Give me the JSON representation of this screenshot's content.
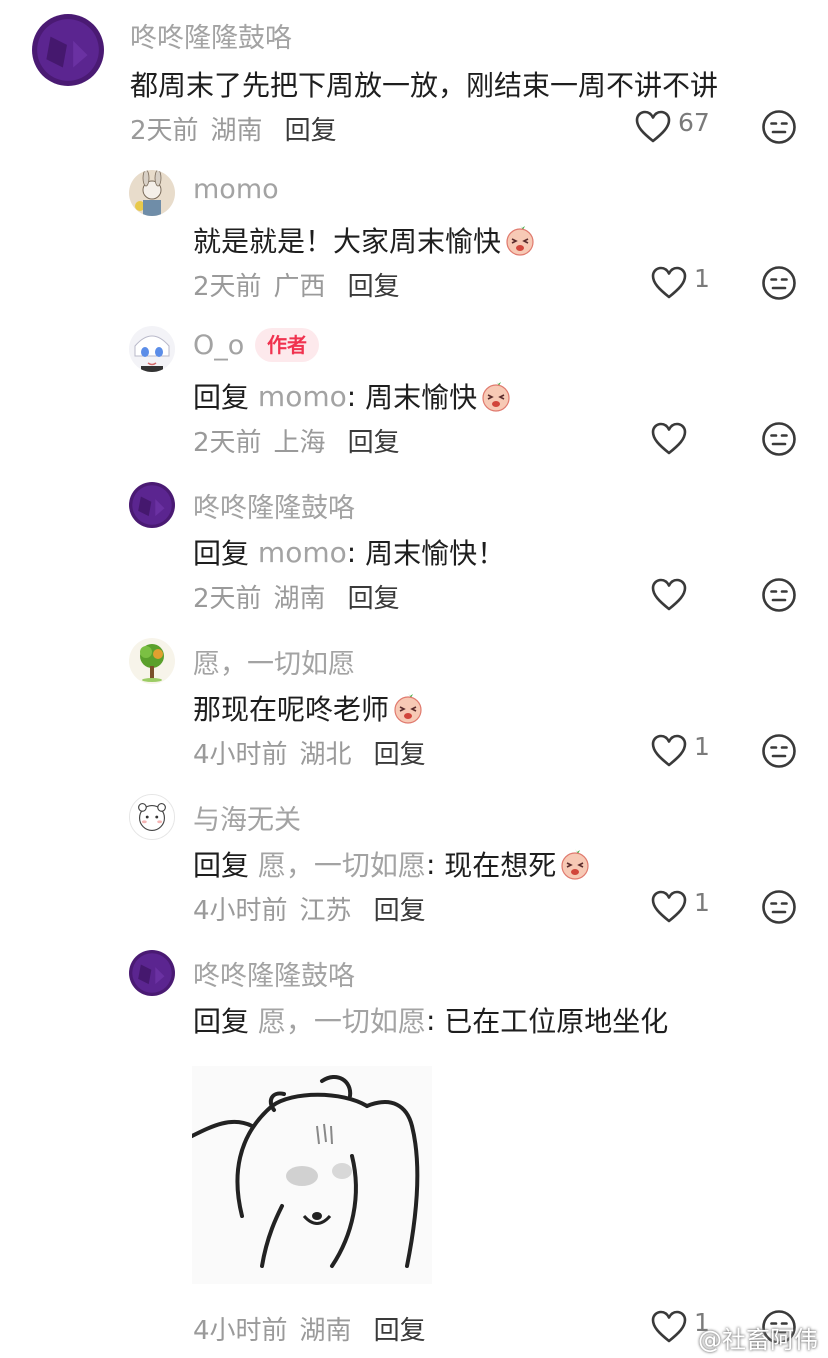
{
  "comments": [
    {
      "username": "咚咚隆隆鼓咯",
      "text": "都周末了先把下周放一放，刚结束一周不讲不讲",
      "time": "2天前",
      "location": "湖南",
      "reply_label": "回复",
      "like_count": "67"
    },
    {
      "username": "momo",
      "text": "就是就是！大家周末愉快",
      "emoji": "happy-face-emoji",
      "time": "2天前",
      "location": "广西",
      "reply_label": "回复",
      "like_count": "1"
    },
    {
      "username": "O_o",
      "badge": "作者",
      "reply_prefix": "回复",
      "reply_to": "momo",
      "colon": ":",
      "text": "周末愉快",
      "emoji": "happy-face-emoji",
      "time": "2天前",
      "location": "上海",
      "reply_label": "回复",
      "like_count": ""
    },
    {
      "username": "咚咚隆隆鼓咯",
      "reply_prefix": "回复",
      "reply_to": "momo",
      "colon": ":",
      "text": "周末愉快！",
      "time": "2天前",
      "location": "湖南",
      "reply_label": "回复",
      "like_count": ""
    },
    {
      "username": "愿，一切如愿",
      "text": "那现在呢咚老师",
      "emoji": "crying-face-emoji",
      "time": "4小时前",
      "location": "湖北",
      "reply_label": "回复",
      "like_count": "1"
    },
    {
      "username": "与海无关",
      "reply_prefix": "回复",
      "reply_to": "愿，一切如愿",
      "colon": ":",
      "text": "现在想死",
      "emoji": "screaming-face-emoji",
      "time": "4小时前",
      "location": "江苏",
      "reply_label": "回复",
      "like_count": "1"
    },
    {
      "username": "咚咚隆隆鼓咯",
      "reply_prefix": "回复",
      "reply_to": "愿，一切如愿",
      "colon": ":",
      "text": "已在工位原地坐化",
      "sticker": "bear-sticker",
      "time": "4小时前",
      "location": "湖南",
      "reply_label": "回复",
      "like_count": "1"
    }
  ],
  "watermark": "@社畜阿伟",
  "colors": {
    "username": "#a3a3a3",
    "author_badge_bg": "#fde9ec",
    "author_badge_text": "#f0324f"
  }
}
